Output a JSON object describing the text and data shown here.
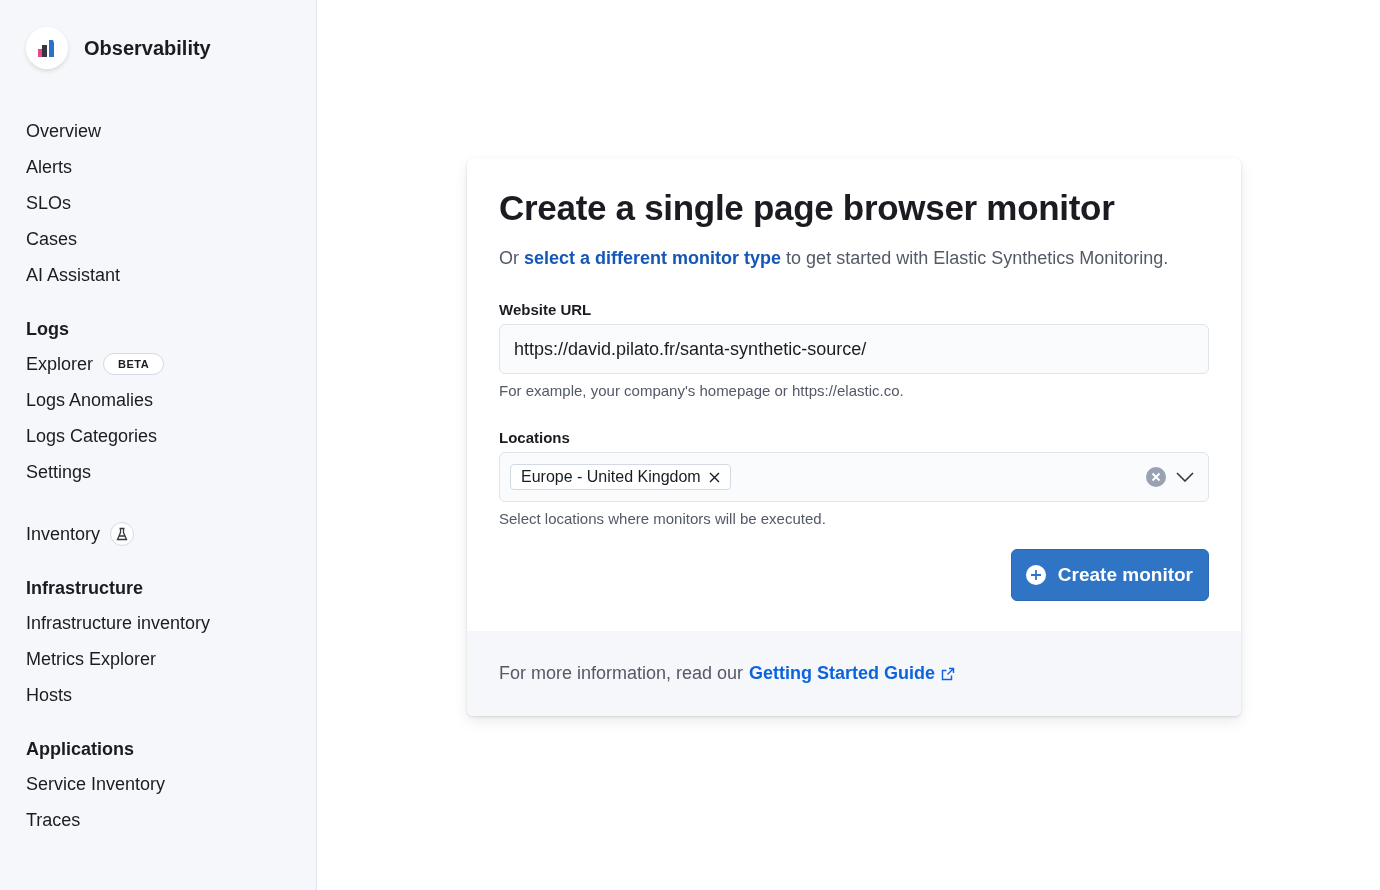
{
  "sidebar": {
    "title": "Observability",
    "sections": [
      {
        "items": [
          {
            "label": "Overview",
            "kind": "link"
          },
          {
            "label": "Alerts",
            "kind": "link"
          },
          {
            "label": "SLOs",
            "kind": "link"
          },
          {
            "label": "Cases",
            "kind": "link"
          },
          {
            "label": "AI Assistant",
            "kind": "link"
          }
        ]
      },
      {
        "heading": "Logs",
        "items": [
          {
            "label": "Explorer",
            "kind": "badge",
            "badge": "BETA"
          },
          {
            "label": "Logs Anomalies",
            "kind": "link"
          },
          {
            "label": "Logs Categories",
            "kind": "link"
          },
          {
            "label": "Settings",
            "kind": "link"
          }
        ]
      },
      {
        "items": [
          {
            "label": "Inventory",
            "kind": "preview"
          }
        ]
      },
      {
        "heading": "Infrastructure",
        "items": [
          {
            "label": "Infrastructure inventory",
            "kind": "link"
          },
          {
            "label": "Metrics Explorer",
            "kind": "link"
          },
          {
            "label": "Hosts",
            "kind": "link"
          }
        ]
      },
      {
        "heading": "Applications",
        "items": [
          {
            "label": "Service Inventory",
            "kind": "link"
          },
          {
            "label": "Traces",
            "kind": "link"
          }
        ]
      }
    ]
  },
  "card": {
    "title": "Create a single page browser monitor",
    "intro": {
      "lead": "Or",
      "link": "select a different monitor type",
      "trail": "to get started with Elastic Synthetics Monitoring."
    },
    "url_field": {
      "label": "Website URL",
      "value": "https://david.pilato.fr/santa-synthetic-source/",
      "help": "For example, your company's homepage or https://elastic.co."
    },
    "locations_field": {
      "label": "Locations",
      "chips": [
        "Europe - United Kingdom"
      ],
      "help": "Select locations where monitors will be executed."
    },
    "submit": "Create monitor",
    "footer": {
      "text": "For more information, read our",
      "link": "Getting Started Guide"
    }
  }
}
